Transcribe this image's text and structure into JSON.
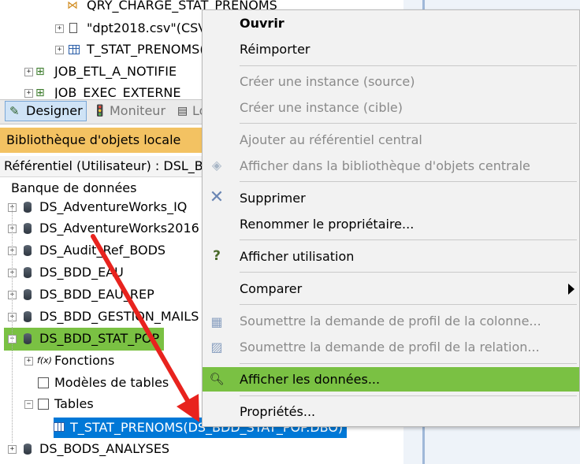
{
  "tree_top": {
    "items": [
      {
        "label": "QRY_CHARGE_STAT_PRENOMS"
      },
      {
        "label": "\"dpt2018.csv\"(CSV"
      },
      {
        "label": "T_STAT_PRENOMS("
      },
      {
        "label": "JOB_ETL_A_NOTIFIE"
      },
      {
        "label": "JOB_EXEC_EXTERNE"
      }
    ]
  },
  "tabs": [
    {
      "label": "Designer"
    },
    {
      "label": "Moniteur"
    },
    {
      "label": "Lo"
    }
  ],
  "library": {
    "title": "Bibliothèque d'objets locale",
    "repo": "Référentiel (Utilisateur) : DSL_BO",
    "section": "Banque de données",
    "datastores": [
      {
        "label": "DS_AdventureWorks_IQ"
      },
      {
        "label": "DS_AdventureWorks2016"
      },
      {
        "label": "DS_Audit_Ref_BODS"
      },
      {
        "label": "DS_BDD_EAU"
      },
      {
        "label": "DS_BDD_EAU_REP"
      },
      {
        "label": "DS_BDD_GESTION_MAILS"
      },
      {
        "label": "DS_BDD_STAT_POP"
      },
      {
        "label": "DS_BODS_ANALYSES"
      }
    ],
    "children": [
      {
        "label": "Fonctions"
      },
      {
        "label": "Modèles de tables"
      },
      {
        "label": "Tables"
      }
    ],
    "selected_table": "T_STAT_PRENOMS(DS_BDD_STAT_POP.DBO)"
  },
  "context_menu": {
    "items": [
      {
        "label": "Ouvrir"
      },
      {
        "label": "Réimporter"
      },
      {
        "label": "Créer une instance (source)"
      },
      {
        "label": "Créer une instance (cible)"
      },
      {
        "label": "Ajouter au référentiel central"
      },
      {
        "label": "Afficher dans la bibliothèque d'objets centrale"
      },
      {
        "label": "Supprimer"
      },
      {
        "label": "Renommer le propriétaire..."
      },
      {
        "label": "Afficher utilisation"
      },
      {
        "label": "Comparer"
      },
      {
        "label": "Soumettre la demande de profil de la colonne..."
      },
      {
        "label": "Soumettre la demande de profil de la relation..."
      },
      {
        "label": "Afficher les données..."
      },
      {
        "label": "Propriétés..."
      }
    ]
  },
  "colors": {
    "highlight_green": "#7ac143",
    "selection_blue": "#0078d7",
    "arrow_red": "#e8231e",
    "header_orange": "#f3c262"
  }
}
